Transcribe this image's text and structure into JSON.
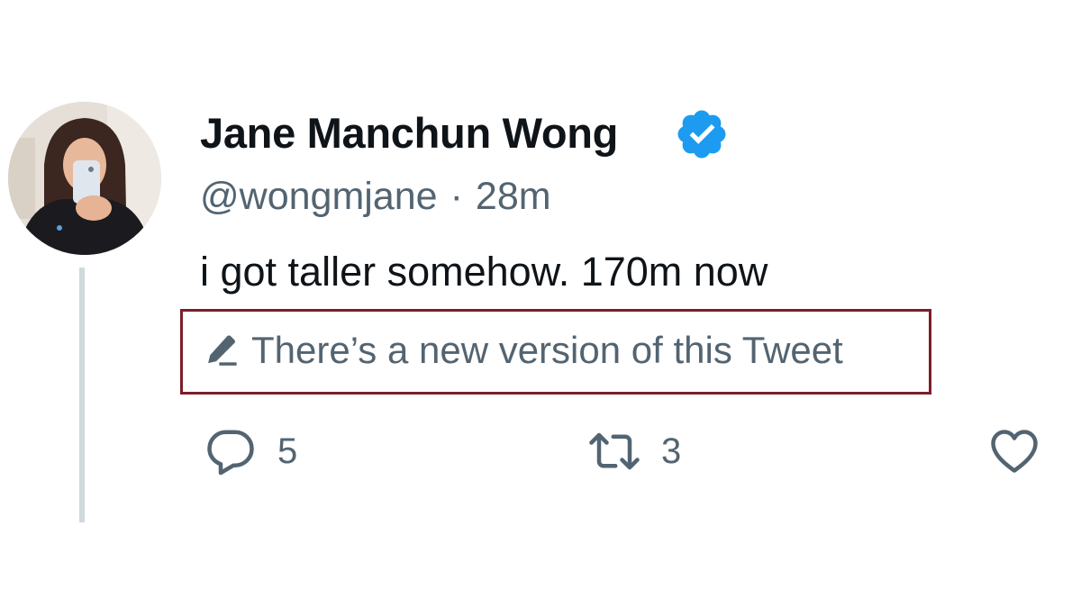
{
  "tweet": {
    "author": {
      "display_name": "Jane Manchun Wong",
      "handle": "@wongmjane",
      "verified_icon": "verified-badge-icon",
      "avatar_icon": "profile-photo"
    },
    "separator": "·",
    "time_ago": "28m",
    "text": "i got taller somehow. 170m now",
    "edit_notice": {
      "icon": "pencil-icon",
      "text": "There’s a new version of this Tweet"
    },
    "actions": {
      "reply": {
        "icon": "reply-icon",
        "count": "5"
      },
      "retweet": {
        "icon": "retweet-icon",
        "count": "3"
      },
      "like": {
        "icon": "heart-icon"
      }
    }
  },
  "colors": {
    "name": "#0f1419",
    "secondary": "#536471",
    "verified": "#1d9bf0",
    "highlight_border": "#7b1e29",
    "thread_line": "#cfd9de"
  }
}
